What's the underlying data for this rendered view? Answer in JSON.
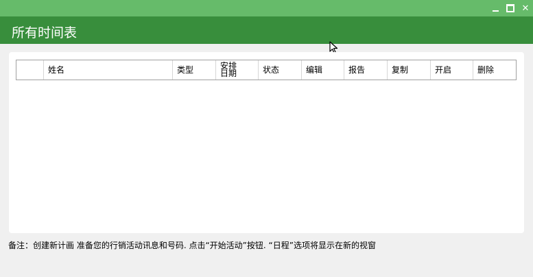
{
  "window": {
    "title": "所有时间表",
    "controls": [
      "minimize-icon",
      "maximize-icon",
      "close-icon"
    ],
    "close_glyph": "✕"
  },
  "table": {
    "columns": [
      {
        "label": ""
      },
      {
        "label": "姓名"
      },
      {
        "label": "类型"
      },
      {
        "label": "安排日期"
      },
      {
        "label": "状态"
      },
      {
        "label": "编辑"
      },
      {
        "label": "报告"
      },
      {
        "label": "复制"
      },
      {
        "label": "开启"
      },
      {
        "label": "删除"
      }
    ],
    "rows": []
  },
  "footer": {
    "note": "备注：创建新计画 准备您的行销活动讯息和号码. 点击“开始活动”按钮. “日程”选项将显示在新的视窗"
  },
  "colors": {
    "titlebar": "#66bb6a",
    "header": "#388e3c",
    "panel": "#ffffff",
    "background": "#f0f0f0"
  }
}
